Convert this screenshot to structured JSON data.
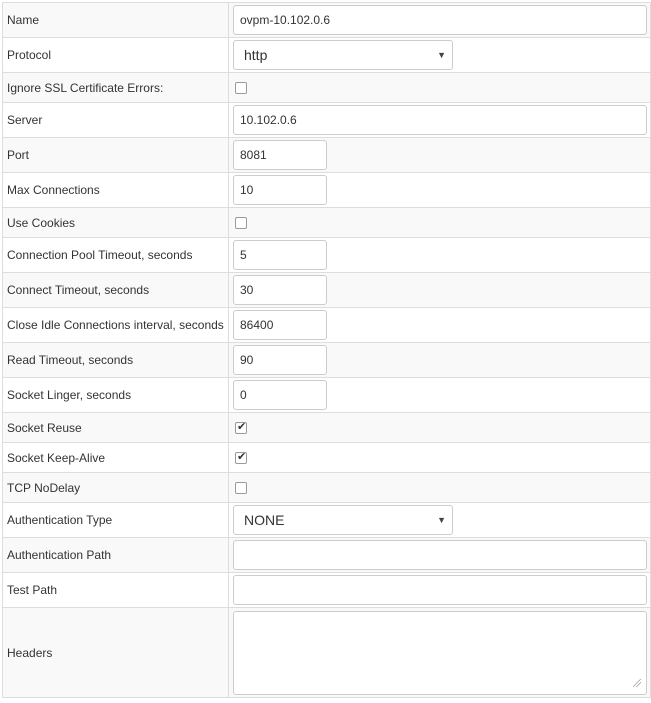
{
  "form": {
    "name": {
      "label": "Name",
      "value": "ovpm-10.102.0.6"
    },
    "protocol": {
      "label": "Protocol",
      "value": "http"
    },
    "ignore_ssl": {
      "label": "Ignore SSL Certificate Errors:",
      "checked": false
    },
    "server": {
      "label": "Server",
      "value": "10.102.0.6"
    },
    "port": {
      "label": "Port",
      "value": "8081"
    },
    "max_connections": {
      "label": "Max Connections",
      "value": "10"
    },
    "use_cookies": {
      "label": "Use Cookies",
      "checked": false
    },
    "pool_timeout": {
      "label": "Connection Pool Timeout, seconds",
      "value": "5"
    },
    "connect_timeout": {
      "label": "Connect Timeout, seconds",
      "value": "30"
    },
    "idle_interval": {
      "label": "Close Idle Connections interval, seconds",
      "value": "86400"
    },
    "read_timeout": {
      "label": "Read Timeout, seconds",
      "value": "90"
    },
    "socket_linger": {
      "label": "Socket Linger, seconds",
      "value": "0"
    },
    "socket_reuse": {
      "label": "Socket Reuse",
      "checked": true
    },
    "keep_alive": {
      "label": "Socket Keep-Alive",
      "checked": true
    },
    "tcp_nodelay": {
      "label": "TCP NoDelay",
      "checked": false
    },
    "auth_type": {
      "label": "Authentication Type",
      "value": "NONE"
    },
    "auth_path": {
      "label": "Authentication Path",
      "value": ""
    },
    "test_path": {
      "label": "Test Path",
      "value": ""
    },
    "headers": {
      "label": "Headers",
      "value": ""
    }
  },
  "icons": {
    "select_caret": "▼",
    "check_mark": "✔"
  }
}
